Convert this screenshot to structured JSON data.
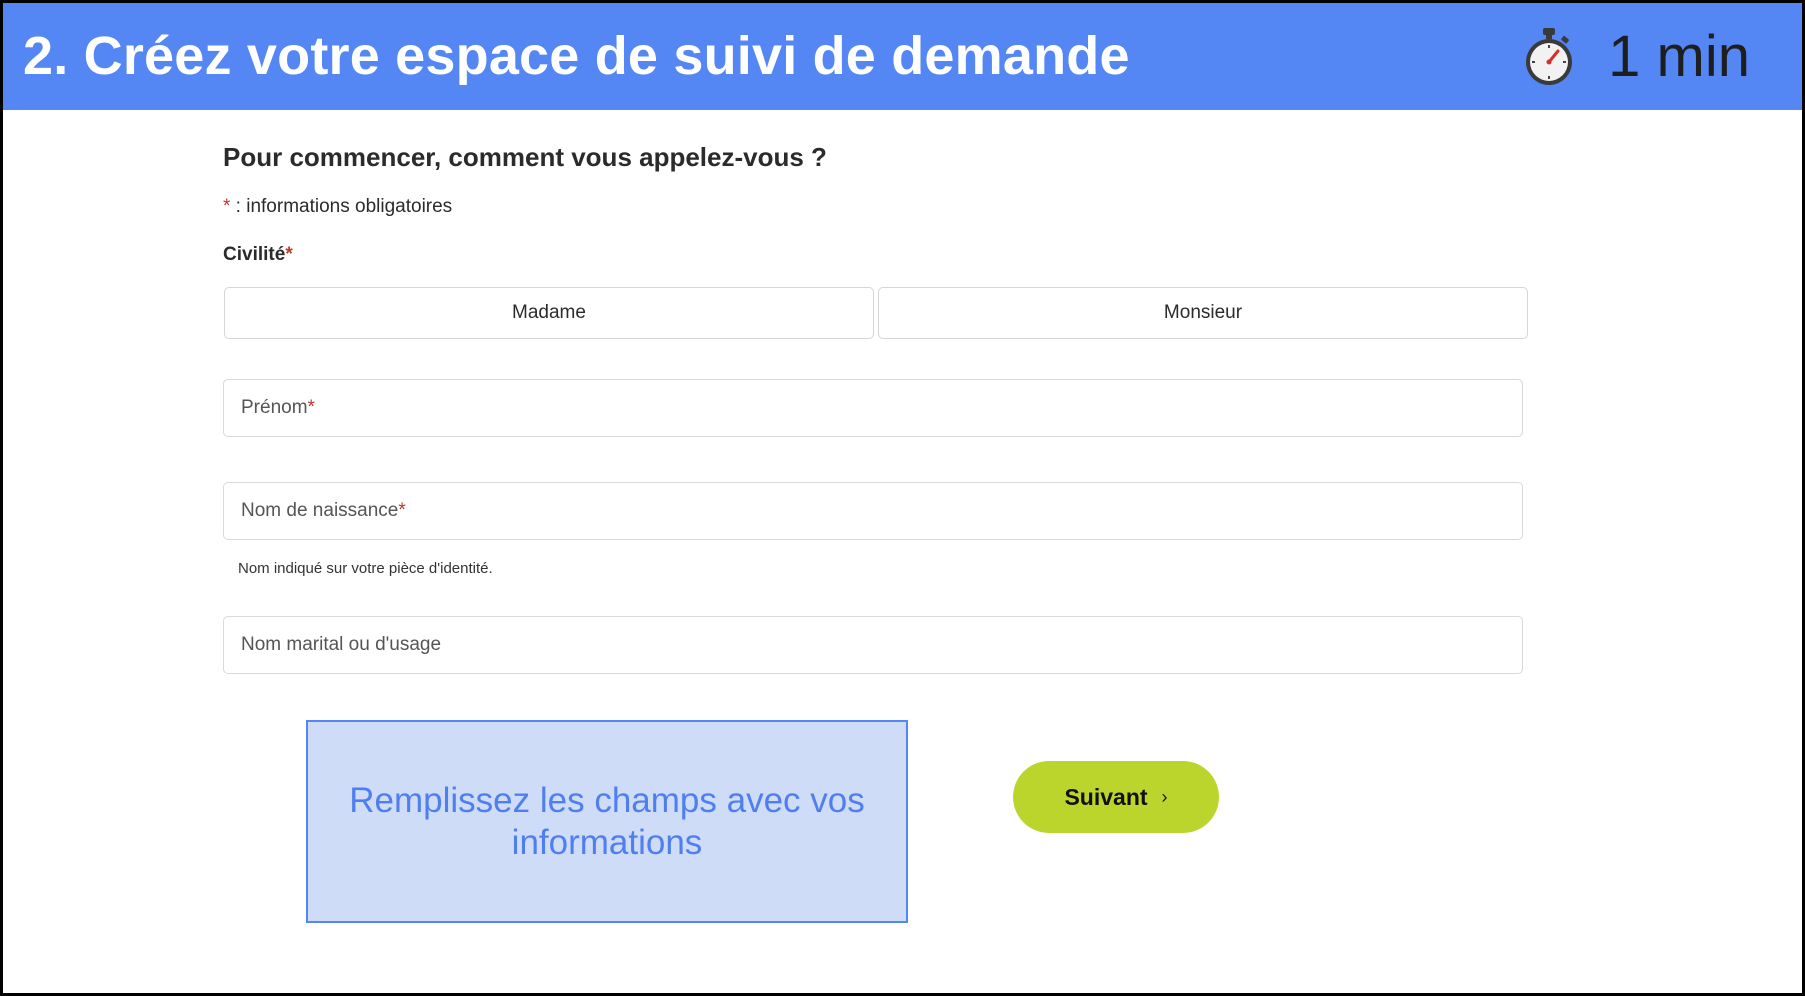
{
  "header": {
    "title": "2. Créez votre espace de suivi de demande",
    "timer_icon": "stopwatch-icon",
    "timer_text": "1 min"
  },
  "form": {
    "heading": "Pour commencer, comment vous appelez-vous ?",
    "required_star": "*",
    "required_note": " : informations obligatoires",
    "civilite": {
      "label": "Civilité",
      "options": [
        "Madame",
        "Monsieur"
      ]
    },
    "fields": {
      "prenom": {
        "placeholder": "Prénom"
      },
      "nom_naissance": {
        "placeholder": "Nom de naissance",
        "help": "Nom indiqué sur votre pièce d'identité."
      },
      "nom_marital": {
        "placeholder": "Nom marital ou d'usage"
      }
    }
  },
  "callout": {
    "text": "Remplissez les champs avec vos informations"
  },
  "next_button": {
    "label": "Suivant",
    "chevron": "›"
  },
  "colors": {
    "header_bg": "#5487f3",
    "callout_bg": "#cfdcf7",
    "button_bg": "#bcd52c",
    "required": "#c0392b"
  }
}
